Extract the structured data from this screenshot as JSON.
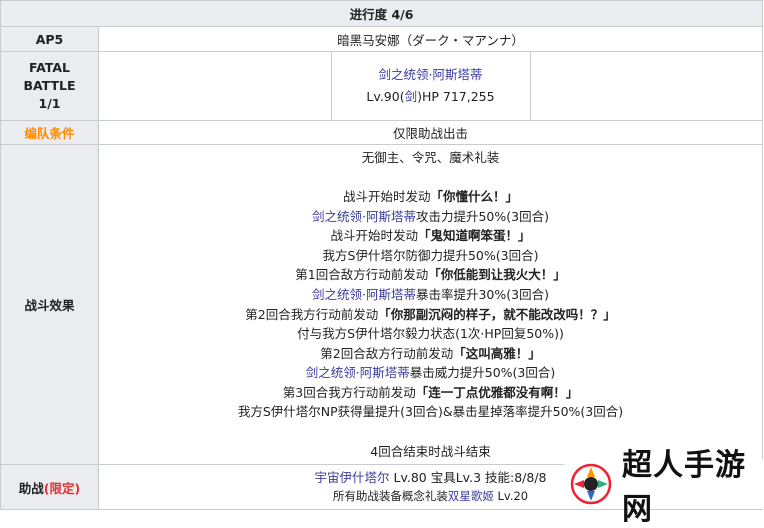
{
  "header": {
    "title": "进行度 4/6"
  },
  "ap": {
    "label": "AP5",
    "enemy_name": "暗黑马安娜（ダーク・マアンナ）"
  },
  "fatal": {
    "label_line1": "FATAL",
    "label_line2": "BATTLE",
    "label_line3": "1/1",
    "boss_name": "剑之统领·阿斯塔蒂",
    "boss_level_prefix": "Lv.90(",
    "boss_class": "剑",
    "boss_hp": ")HP 717,255"
  },
  "formation": {
    "label": "编队条件",
    "value": "仅限助战出击"
  },
  "effects": {
    "label": "战斗效果",
    "lines": [
      {
        "parts": [
          {
            "t": "无御主、令咒、魔术礼装",
            "s": "plain"
          }
        ]
      },
      {
        "parts": [
          {
            "t": "",
            "s": "plain"
          }
        ]
      },
      {
        "parts": [
          {
            "t": "战斗开始时发动",
            "s": "plain"
          },
          {
            "t": "「你懂什么！」",
            "s": "bold"
          }
        ]
      },
      {
        "parts": [
          {
            "t": "剑之统领·阿斯塔蒂",
            "s": "link"
          },
          {
            "t": "攻击力提升50%(3回合)",
            "s": "plain"
          }
        ]
      },
      {
        "parts": [
          {
            "t": "战斗开始时发动",
            "s": "plain"
          },
          {
            "t": "「鬼知道啊笨蛋！」",
            "s": "bold"
          }
        ]
      },
      {
        "parts": [
          {
            "t": "我方S伊什塔尔",
            "s": "plain"
          },
          {
            "t": "防御力提升50%(3回合)",
            "s": "plain"
          }
        ]
      },
      {
        "parts": [
          {
            "t": "第1回合敌方行动前发动",
            "s": "plain"
          },
          {
            "t": "「你低能到让我火大！」",
            "s": "bold"
          }
        ]
      },
      {
        "parts": [
          {
            "t": "剑之统领·阿斯塔蒂",
            "s": "link"
          },
          {
            "t": "暴击率提升30%(3回合)",
            "s": "plain"
          }
        ]
      },
      {
        "parts": [
          {
            "t": "第2回合我方行动前发动",
            "s": "plain"
          },
          {
            "t": "「你那副沉闷的样子，就不能改改吗！？」",
            "s": "bold"
          }
        ]
      },
      {
        "parts": [
          {
            "t": "付与我方S伊什塔尔",
            "s": "plain"
          },
          {
            "t": "毅力状态(1次·HP回复50%))",
            "s": "plain"
          }
        ]
      },
      {
        "parts": [
          {
            "t": "第2回合敌方行动前发动",
            "s": "plain"
          },
          {
            "t": "「这叫高雅！」",
            "s": "bold"
          }
        ]
      },
      {
        "parts": [
          {
            "t": "剑之统领·阿斯塔蒂",
            "s": "link"
          },
          {
            "t": "暴击威力提升50%(3回合)",
            "s": "plain"
          }
        ]
      },
      {
        "parts": [
          {
            "t": "第3回合我方行动前发动",
            "s": "plain"
          },
          {
            "t": "「连一丁点优雅都没有啊！」",
            "s": "bold"
          }
        ]
      },
      {
        "parts": [
          {
            "t": "我方S伊什塔尔",
            "s": "plain"
          },
          {
            "t": "NP获得量提升(3回合)&暴击星掉落率提升50%(3回合)",
            "s": "plain"
          }
        ]
      },
      {
        "parts": [
          {
            "t": "",
            "s": "plain"
          }
        ]
      },
      {
        "parts": [
          {
            "t": "4回合结束时战斗结束",
            "s": "plain"
          }
        ]
      }
    ]
  },
  "support": {
    "label": "助战",
    "label_tag": "(限定)",
    "line1_name": "宇宙伊什塔尔",
    "line1_rest": " Lv.80 宝具Lv.3 技能:8/8/8",
    "line2_prefix": "所有助战装备概念礼装",
    "line2_ce": "双星歌姬",
    "line2_suffix": " Lv.20"
  },
  "watermark": {
    "text": "超人手游网"
  },
  "colors": {
    "header_bg": "#eaecf0",
    "border": "#c8ccd1",
    "link": "#3a3a9e",
    "orange": "#ff8c00",
    "red": "#dd3333"
  }
}
